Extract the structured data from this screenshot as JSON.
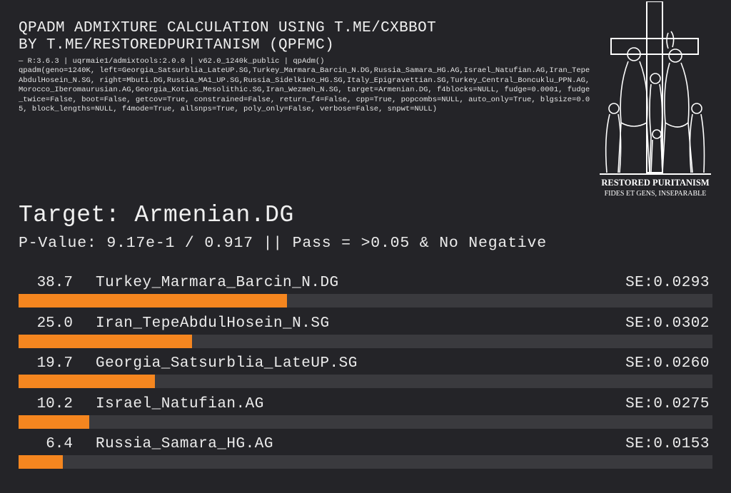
{
  "header": {
    "title_line1": "QPADM ADMIXTURE CALCULATION USING T.ME/CXBBOT",
    "title_line2": "BY T.ME/RESTOREDPURITANISM (QPFMC)",
    "meta_line": "— R:3.6.3 | uqrmaie1/admixtools:2.0.0 | v62.0_1240k_public | qpAdm()",
    "command": "qpadm(geno=1240K, left=Georgia_Satsurblia_LateUP.SG,Turkey_Marmara_Barcin_N.DG,Russia_Samara_HG.AG,Israel_Natufian.AG,Iran_TepeAbdulHosein_N.SG, right=Mbuti.DG,Russia_MA1_UP.SG,Russia_Sidelkino_HG.SG,Italy_Epigravettian.SG,Turkey_Central_Boncuklu_PPN.AG,Morocco_Iberomaurusian.AG,Georgia_Kotias_Mesolithic.SG,Iran_Wezmeh_N.SG, target=Armenian.DG, f4blocks=NULL, fudge=0.0001, fudge_twice=False, boot=False, getcov=True, constrained=False, return_f4=False, cpp=True, popcombs=NULL, auto_only=True, blgsize=0.05, block_lengths=NULL, f4mode=True, allsnps=True, poly_only=False, verbose=False, snpwt=NULL)"
  },
  "logo": {
    "icon": "crucifixion-emblem-icon",
    "text_line1": "RESTORED PURITANISM",
    "text_line2": "FIDES ET GENS, INSEPARABLE"
  },
  "result": {
    "target_text": "Target: Armenian.DG",
    "pvalue_text": "P-Value: 9.17e-1 / 0.917 || Pass = >0.05 & No Negative"
  },
  "colors": {
    "bar": "#f5861f",
    "track": "#3a3a3e",
    "background": "#242428"
  },
  "chart_data": {
    "type": "bar",
    "orientation": "horizontal",
    "xlim": [
      0,
      100
    ],
    "categories": [
      "Turkey_Marmara_Barcin_N.DG",
      "Iran_TepeAbdulHosein_N.SG",
      "Georgia_Satsurblia_LateUP.SG",
      "Israel_Natufian.AG",
      "Russia_Samara_HG.AG"
    ],
    "values": [
      38.7,
      25.0,
      19.7,
      10.2,
      6.4
    ],
    "value_labels": [
      "38.7",
      "25.0",
      "19.7",
      "10.2",
      "6.4"
    ],
    "se_labels": [
      "SE:0.0293",
      "SE:0.0302",
      "SE:0.0260",
      "SE:0.0275",
      "SE:0.0153"
    ]
  }
}
